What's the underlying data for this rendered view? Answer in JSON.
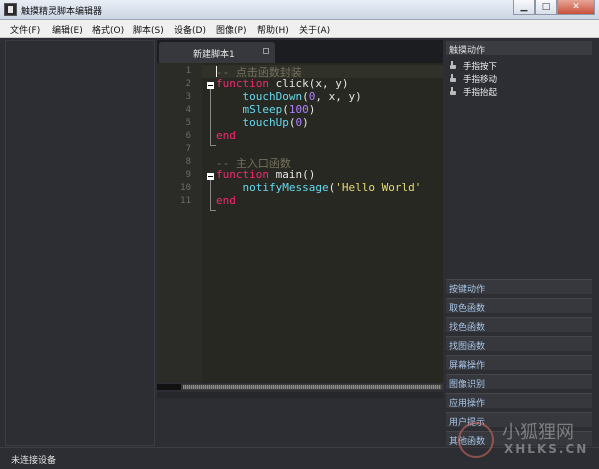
{
  "window": {
    "title": "触摸精灵脚本编辑器",
    "min_label": "▁",
    "max_label": "□",
    "close_label": "✕"
  },
  "menu": [
    "文件(F)",
    "编辑(E)",
    "格式(O)",
    "脚本(S)",
    "设备(D)",
    "图像(P)",
    "帮助(H)",
    "关于(A)"
  ],
  "editor": {
    "tab_label": "新建脚本1",
    "line_numbers": [
      "1",
      "2",
      "3",
      "4",
      "5",
      "6",
      "7",
      "8",
      "9",
      "10",
      "11"
    ],
    "lines": [
      [
        {
          "t": "-- 点击函数封装",
          "c": "cmt"
        }
      ],
      [
        {
          "t": "function",
          "c": "kw"
        },
        {
          "t": " click(x, y)",
          "c": "fn"
        }
      ],
      [
        {
          "t": "    touchDown",
          "c": "call"
        },
        {
          "t": "(",
          "c": "plain"
        },
        {
          "t": "0",
          "c": "num"
        },
        {
          "t": ", x, y)",
          "c": "plain"
        }
      ],
      [
        {
          "t": "    mSleep",
          "c": "call"
        },
        {
          "t": "(",
          "c": "plain"
        },
        {
          "t": "100",
          "c": "num"
        },
        {
          "t": ")",
          "c": "plain"
        }
      ],
      [
        {
          "t": "    touchUp",
          "c": "call"
        },
        {
          "t": "(",
          "c": "plain"
        },
        {
          "t": "0",
          "c": "num"
        },
        {
          "t": ")",
          "c": "plain"
        }
      ],
      [
        {
          "t": "end",
          "c": "kw"
        }
      ],
      [],
      [
        {
          "t": "-- 主入口函数",
          "c": "cmt"
        }
      ],
      [
        {
          "t": "function",
          "c": "kw"
        },
        {
          "t": " main()",
          "c": "fn"
        }
      ],
      [
        {
          "t": "    notifyMessage",
          "c": "call"
        },
        {
          "t": "(",
          "c": "plain"
        },
        {
          "t": "'Hello World'",
          "c": "str"
        }
      ],
      [
        {
          "t": "end",
          "c": "kw"
        }
      ]
    ]
  },
  "right_panel": {
    "header": "触摸动作",
    "actions": [
      "手指按下",
      "手指移动",
      "手指抬起"
    ],
    "categories": [
      "按键动作",
      "取色函数",
      "找色函数",
      "找图函数",
      "屏幕操作",
      "图像识别",
      "应用操作",
      "用户提示",
      "其他函数"
    ]
  },
  "status": {
    "text": "未连接设备"
  },
  "watermark": {
    "cn": "小狐狸网",
    "en": "XHLKS.CN"
  },
  "colors": {
    "keyword": "#f92672",
    "builtin": "#66d9ef",
    "number": "#ae81ff",
    "comment": "#75715e",
    "string": "#e6db74",
    "editor_bg": "#272822"
  }
}
